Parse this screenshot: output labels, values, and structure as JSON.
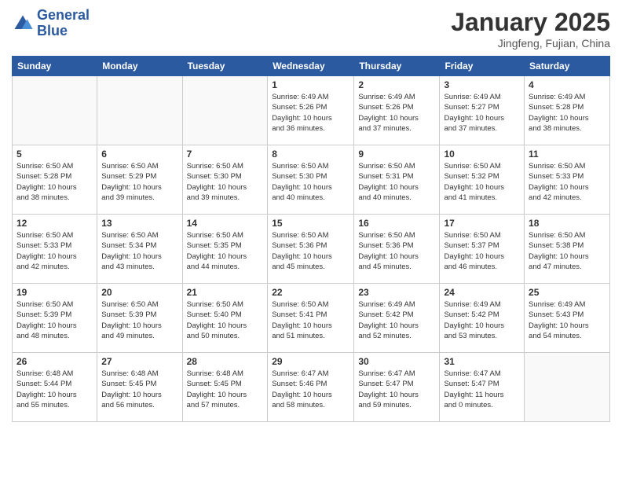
{
  "header": {
    "logo_line1": "General",
    "logo_line2": "Blue",
    "month_title": "January 2025",
    "location": "Jingfeng, Fujian, China"
  },
  "days_of_week": [
    "Sunday",
    "Monday",
    "Tuesday",
    "Wednesday",
    "Thursday",
    "Friday",
    "Saturday"
  ],
  "weeks": [
    [
      {
        "num": "",
        "info": ""
      },
      {
        "num": "",
        "info": ""
      },
      {
        "num": "",
        "info": ""
      },
      {
        "num": "1",
        "info": "Sunrise: 6:49 AM\nSunset: 5:26 PM\nDaylight: 10 hours\nand 36 minutes."
      },
      {
        "num": "2",
        "info": "Sunrise: 6:49 AM\nSunset: 5:26 PM\nDaylight: 10 hours\nand 37 minutes."
      },
      {
        "num": "3",
        "info": "Sunrise: 6:49 AM\nSunset: 5:27 PM\nDaylight: 10 hours\nand 37 minutes."
      },
      {
        "num": "4",
        "info": "Sunrise: 6:49 AM\nSunset: 5:28 PM\nDaylight: 10 hours\nand 38 minutes."
      }
    ],
    [
      {
        "num": "5",
        "info": "Sunrise: 6:50 AM\nSunset: 5:28 PM\nDaylight: 10 hours\nand 38 minutes."
      },
      {
        "num": "6",
        "info": "Sunrise: 6:50 AM\nSunset: 5:29 PM\nDaylight: 10 hours\nand 39 minutes."
      },
      {
        "num": "7",
        "info": "Sunrise: 6:50 AM\nSunset: 5:30 PM\nDaylight: 10 hours\nand 39 minutes."
      },
      {
        "num": "8",
        "info": "Sunrise: 6:50 AM\nSunset: 5:30 PM\nDaylight: 10 hours\nand 40 minutes."
      },
      {
        "num": "9",
        "info": "Sunrise: 6:50 AM\nSunset: 5:31 PM\nDaylight: 10 hours\nand 40 minutes."
      },
      {
        "num": "10",
        "info": "Sunrise: 6:50 AM\nSunset: 5:32 PM\nDaylight: 10 hours\nand 41 minutes."
      },
      {
        "num": "11",
        "info": "Sunrise: 6:50 AM\nSunset: 5:33 PM\nDaylight: 10 hours\nand 42 minutes."
      }
    ],
    [
      {
        "num": "12",
        "info": "Sunrise: 6:50 AM\nSunset: 5:33 PM\nDaylight: 10 hours\nand 42 minutes."
      },
      {
        "num": "13",
        "info": "Sunrise: 6:50 AM\nSunset: 5:34 PM\nDaylight: 10 hours\nand 43 minutes."
      },
      {
        "num": "14",
        "info": "Sunrise: 6:50 AM\nSunset: 5:35 PM\nDaylight: 10 hours\nand 44 minutes."
      },
      {
        "num": "15",
        "info": "Sunrise: 6:50 AM\nSunset: 5:36 PM\nDaylight: 10 hours\nand 45 minutes."
      },
      {
        "num": "16",
        "info": "Sunrise: 6:50 AM\nSunset: 5:36 PM\nDaylight: 10 hours\nand 45 minutes."
      },
      {
        "num": "17",
        "info": "Sunrise: 6:50 AM\nSunset: 5:37 PM\nDaylight: 10 hours\nand 46 minutes."
      },
      {
        "num": "18",
        "info": "Sunrise: 6:50 AM\nSunset: 5:38 PM\nDaylight: 10 hours\nand 47 minutes."
      }
    ],
    [
      {
        "num": "19",
        "info": "Sunrise: 6:50 AM\nSunset: 5:39 PM\nDaylight: 10 hours\nand 48 minutes."
      },
      {
        "num": "20",
        "info": "Sunrise: 6:50 AM\nSunset: 5:39 PM\nDaylight: 10 hours\nand 49 minutes."
      },
      {
        "num": "21",
        "info": "Sunrise: 6:50 AM\nSunset: 5:40 PM\nDaylight: 10 hours\nand 50 minutes."
      },
      {
        "num": "22",
        "info": "Sunrise: 6:50 AM\nSunset: 5:41 PM\nDaylight: 10 hours\nand 51 minutes."
      },
      {
        "num": "23",
        "info": "Sunrise: 6:49 AM\nSunset: 5:42 PM\nDaylight: 10 hours\nand 52 minutes."
      },
      {
        "num": "24",
        "info": "Sunrise: 6:49 AM\nSunset: 5:42 PM\nDaylight: 10 hours\nand 53 minutes."
      },
      {
        "num": "25",
        "info": "Sunrise: 6:49 AM\nSunset: 5:43 PM\nDaylight: 10 hours\nand 54 minutes."
      }
    ],
    [
      {
        "num": "26",
        "info": "Sunrise: 6:48 AM\nSunset: 5:44 PM\nDaylight: 10 hours\nand 55 minutes."
      },
      {
        "num": "27",
        "info": "Sunrise: 6:48 AM\nSunset: 5:45 PM\nDaylight: 10 hours\nand 56 minutes."
      },
      {
        "num": "28",
        "info": "Sunrise: 6:48 AM\nSunset: 5:45 PM\nDaylight: 10 hours\nand 57 minutes."
      },
      {
        "num": "29",
        "info": "Sunrise: 6:47 AM\nSunset: 5:46 PM\nDaylight: 10 hours\nand 58 minutes."
      },
      {
        "num": "30",
        "info": "Sunrise: 6:47 AM\nSunset: 5:47 PM\nDaylight: 10 hours\nand 59 minutes."
      },
      {
        "num": "31",
        "info": "Sunrise: 6:47 AM\nSunset: 5:47 PM\nDaylight: 11 hours\nand 0 minutes."
      },
      {
        "num": "",
        "info": ""
      }
    ]
  ]
}
